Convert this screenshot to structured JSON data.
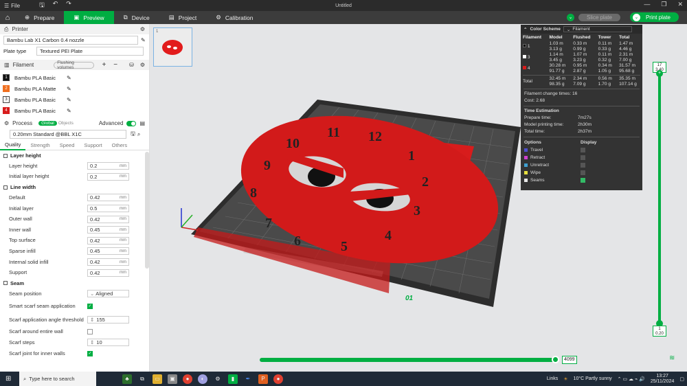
{
  "titlebar": {
    "file_label": "File",
    "title": "Untitled"
  },
  "mainbar": {
    "tabs": [
      {
        "label": "Prepare"
      },
      {
        "label": "Preview"
      },
      {
        "label": "Device"
      },
      {
        "label": "Project"
      },
      {
        "label": "Calibration"
      }
    ],
    "slice_label": "Slice plate",
    "print_label": "Print plate"
  },
  "sidebar": {
    "printer": {
      "title": "Printer",
      "printer_name": "Bambu Lab X1 Carbon 0.4 nozzle",
      "plate_type_label": "Plate type",
      "plate_type": "Textured PEI Plate"
    },
    "filament": {
      "title": "Filament",
      "flushing_label": "Flushing volumes",
      "items": [
        {
          "num": "1",
          "name": "Bambu PLA Basic",
          "color": "#111111"
        },
        {
          "num": "2",
          "name": "Bambu PLA Matte",
          "color": "#f07020"
        },
        {
          "num": "3",
          "name": "Bambu PLA Basic",
          "color": "#ffffff"
        },
        {
          "num": "4",
          "name": "Bambu PLA Basic",
          "color": "#d81c1c"
        }
      ]
    },
    "process": {
      "title": "Process",
      "global_label": "Global",
      "objects_label": "Objects",
      "advanced_label": "Advanced",
      "preset": "0.20mm Standard @BBL X1C",
      "tabs": [
        "Quality",
        "Strength",
        "Speed",
        "Support",
        "Others"
      ]
    },
    "groups": {
      "layer_height": {
        "title": "Layer height",
        "params": [
          {
            "label": "Layer height",
            "value": "0.2",
            "unit": "mm"
          },
          {
            "label": "Initial layer height",
            "value": "0.2",
            "unit": "mm"
          }
        ]
      },
      "line_width": {
        "title": "Line width",
        "params": [
          {
            "label": "Default",
            "value": "0.42",
            "unit": "mm"
          },
          {
            "label": "Initial layer",
            "value": "0.5",
            "unit": "mm"
          },
          {
            "label": "Outer wall",
            "value": "0.42",
            "unit": "mm"
          },
          {
            "label": "Inner wall",
            "value": "0.45",
            "unit": "mm"
          },
          {
            "label": "Top surface",
            "value": "0.42",
            "unit": "mm"
          },
          {
            "label": "Sparse infill",
            "value": "0.45",
            "unit": "mm"
          },
          {
            "label": "Internal solid infill",
            "value": "0.42",
            "unit": "mm"
          },
          {
            "label": "Support",
            "value": "0.42",
            "unit": "mm"
          }
        ]
      },
      "seam": {
        "title": "Seam",
        "seam_position_label": "Seam position",
        "seam_position": "Aligned",
        "smart_scarf_label": "Smart scarf seam application",
        "scarf_angle_label": "Scarf application angle threshold",
        "scarf_angle": "155",
        "scarf_around_label": "Scarf around entire wall",
        "scarf_steps_label": "Scarf steps",
        "scarf_steps": "10",
        "scarf_inner_label": "Scarf joint for inner walls"
      }
    }
  },
  "viewport": {
    "plate_number": "1",
    "plate_label": "01",
    "clock_numbers": [
      "12",
      "1",
      "2",
      "3",
      "4",
      "5",
      "6",
      "7",
      "8",
      "9",
      "10",
      "11"
    ],
    "layer_slider": {
      "top_layer": "17",
      "top_height": "3.40",
      "bottom_layer": "1",
      "bottom_height": "0.20"
    },
    "move_slider": {
      "value": "4099"
    }
  },
  "stats": {
    "color_scheme_label": "Color Scheme",
    "scheme_value": "Filament",
    "headers": [
      "Filament",
      "Model",
      "Flushed",
      "Tower",
      "Total"
    ],
    "rows": [
      {
        "id": "1",
        "color": "#111111",
        "model": "1.03 m",
        "model_g": "3.13 g",
        "flushed": "0.33 m",
        "flushed_g": "0.99 g",
        "tower": "0.11 m",
        "tower_g": "0.33 g",
        "total": "1.47 m",
        "total_g": "4.46 g"
      },
      {
        "id": "3",
        "color": "#ffffff",
        "model": "1.14 m",
        "model_g": "3.45 g",
        "flushed": "1.07 m",
        "flushed_g": "3.23 g",
        "tower": "0.11 m",
        "tower_g": "0.32 g",
        "total": "2.31 m",
        "total_g": "7.00 g"
      },
      {
        "id": "4",
        "color": "#d81c1c",
        "model": "30.28 m",
        "model_g": "91.77 g",
        "flushed": "0.95 m",
        "flushed_g": "2.87 g",
        "tower": "0.34 m",
        "tower_g": "1.05 g",
        "total": "31.57 m",
        "total_g": "95.68 g"
      }
    ],
    "total": {
      "label": "Total",
      "model": "32.45 m",
      "model_g": "98.35 g",
      "flushed": "2.34 m",
      "flushed_g": "7.09 g",
      "tower": "0.56 m",
      "tower_g": "1.70 g",
      "total": "35.35 m",
      "total_g": "107.14 g"
    },
    "change_times_label": "Filament change times:",
    "change_times": "16",
    "cost_label": "Cost:",
    "cost": "2.68",
    "time_title": "Time Estimation",
    "prepare_label": "Prepare time:",
    "prepare": "7m27s",
    "model_time_label": "Model printing time:",
    "model_time": "2h30m",
    "total_time_label": "Total time:",
    "total_time": "2h37m",
    "options_label": "Options",
    "display_label": "Display",
    "options": [
      {
        "name": "Travel",
        "color": "#5050d0",
        "on": false
      },
      {
        "name": "Retract",
        "color": "#d040d0",
        "on": false
      },
      {
        "name": "Unretract",
        "color": "#40a0d0",
        "on": false
      },
      {
        "name": "Wipe",
        "color": "#e8e040",
        "on": false
      },
      {
        "name": "Seams",
        "color": "#e8e8e8",
        "on": true
      }
    ]
  },
  "taskbar": {
    "search_placeholder": "Type here to search",
    "links_label": "Links",
    "weather": "10°C  Partly sunny",
    "time": "13:27",
    "date": "25/11/2024"
  }
}
